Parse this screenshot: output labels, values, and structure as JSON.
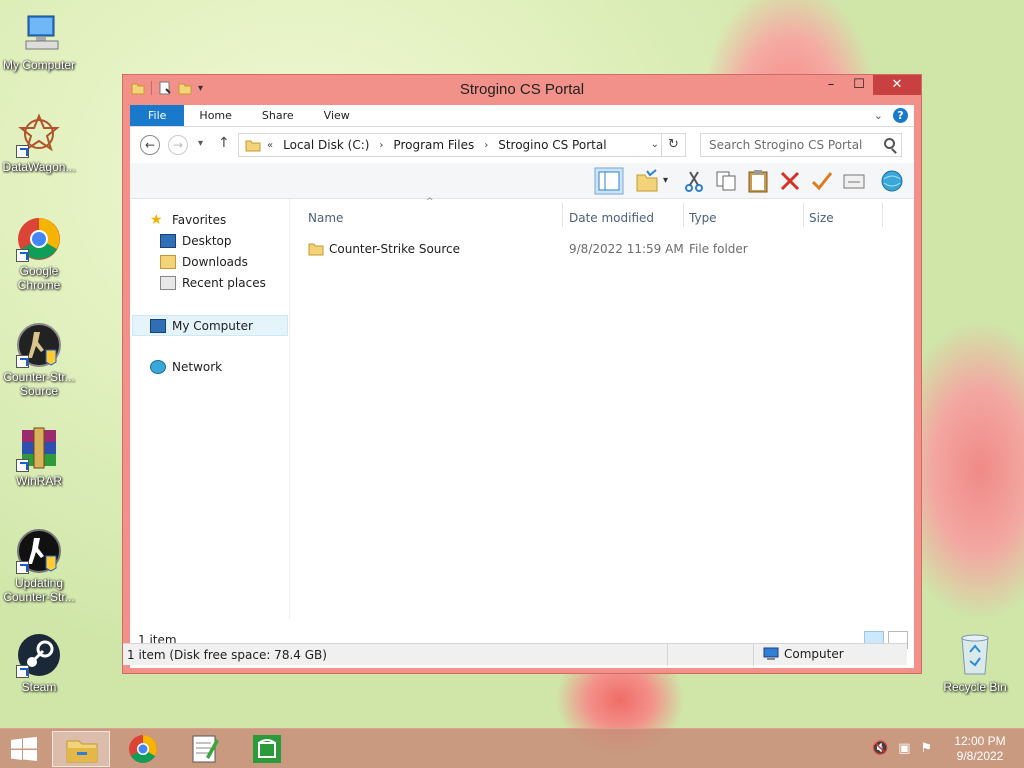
{
  "desktop": {
    "icons": [
      {
        "label": "My Computer"
      },
      {
        "label": "DataWagon..."
      },
      {
        "label": "Google Chrome"
      },
      {
        "label": "Counter-Str... Source"
      },
      {
        "label": "WinRAR"
      },
      {
        "label": "Updating Counter-Str..."
      },
      {
        "label": "Steam"
      },
      {
        "label": "Recycle Bin"
      }
    ]
  },
  "window": {
    "title": "Strogino CS Portal",
    "ribbon_tabs": [
      "File",
      "Home",
      "Share",
      "View"
    ],
    "help_label": "?",
    "address": {
      "prefix": "«",
      "crumbs": [
        "Local Disk (C:)",
        "Program Files",
        "Strogino CS Portal"
      ]
    },
    "search_placeholder": "Search Strogino CS Portal",
    "nav": {
      "favorites": "Favorites",
      "desktop": "Desktop",
      "downloads": "Downloads",
      "recent": "Recent places",
      "my_computer": "My Computer",
      "network": "Network"
    },
    "columns": [
      "Name",
      "Date modified",
      "Type",
      "Size"
    ],
    "files": [
      {
        "name": "Counter-Strike Source",
        "date": "9/8/2022 11:59 AM",
        "type": "File folder",
        "size": ""
      }
    ],
    "item_count": "1 item",
    "status_left": "1 item (Disk free space: 78.4 GB)",
    "status_right": "Computer"
  },
  "taskbar": {
    "time": "12:00 PM",
    "date": "9/8/2022"
  },
  "colors": {
    "accent": "#1979ca",
    "window_frame": "#f2908a",
    "close": "#c94040"
  }
}
